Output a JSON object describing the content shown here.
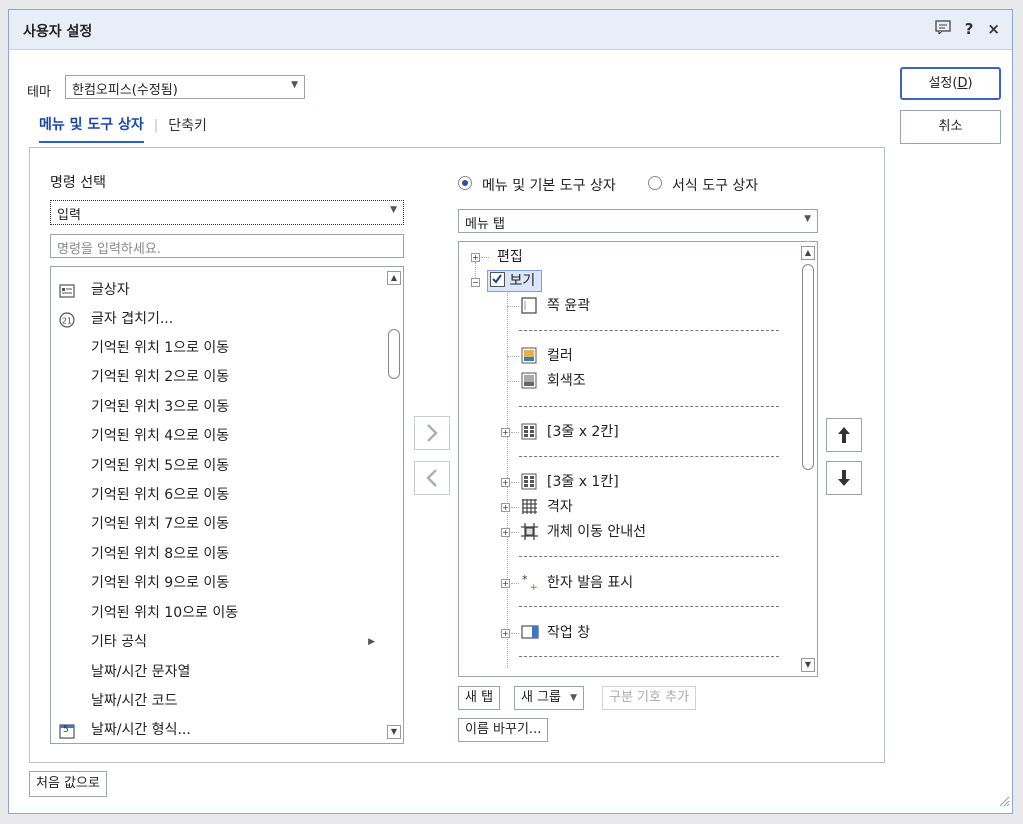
{
  "window": {
    "title": "사용자 설정",
    "help_glyph": "?",
    "close_glyph": "×"
  },
  "theme": {
    "label": "테마",
    "value": "한컴오피스(수정됨)"
  },
  "tabs": [
    {
      "label": "메뉴 및 도구 상자"
    },
    {
      "label": "단축키"
    }
  ],
  "buttons": {
    "ok_prefix": "설정(",
    "ok_key": "D",
    "ok_suffix": ")",
    "cancel": "취소",
    "reset": "처음 값으로"
  },
  "left": {
    "header": "명령 선택",
    "category": "입력",
    "search_placeholder": "명령을 입력하세요.",
    "items": [
      {
        "label": "글상자",
        "icon": "textbox-icon"
      },
      {
        "label": "글자 겹치기...",
        "icon": "char-overlap-icon"
      },
      {
        "label": "기억된 위치 1으로 이동"
      },
      {
        "label": "기억된 위치 2으로 이동"
      },
      {
        "label": "기억된 위치 3으로 이동"
      },
      {
        "label": "기억된 위치 4으로 이동"
      },
      {
        "label": "기억된 위치 5으로 이동"
      },
      {
        "label": "기억된 위치 6으로 이동"
      },
      {
        "label": "기억된 위치 7으로 이동"
      },
      {
        "label": "기억된 위치 8으로 이동"
      },
      {
        "label": "기억된 위치 9으로 이동"
      },
      {
        "label": "기억된 위치 10으로 이동"
      },
      {
        "label": "기타 공식",
        "submenu": true
      },
      {
        "label": "날짜/시간 문자열"
      },
      {
        "label": "날짜/시간 코드"
      },
      {
        "label": "날짜/시간 형식...",
        "icon": "calendar-icon"
      }
    ],
    "calendar_glyph": "5"
  },
  "right": {
    "radio_menu": "메뉴 및 기본 도구 상자",
    "radio_format": "서식 도구 상자",
    "selected_radio": "menu",
    "dropdown": "메뉴 탭",
    "tree": {
      "edit": "편집",
      "view": "보기",
      "page_outline": "쪽 윤곽",
      "color": "컬러",
      "grayscale": "회색조",
      "layout_3x2": "[3줄 x 2칸]",
      "layout_3x1": "[3줄 x 1칸]",
      "grid": "격자",
      "object_guide": "개체 이동 안내선",
      "hanja": "한자 발음 표시",
      "task_pane": "작업 창"
    },
    "new_tab": "새 탭",
    "new_group": "새 그룹",
    "add_separator": "구분 기호 추가",
    "rename": "이름 바꾸기..."
  },
  "colors": {
    "accent": "#2a5cc7",
    "title_bg": "#e8eef8",
    "border": "#8fa6cf"
  }
}
